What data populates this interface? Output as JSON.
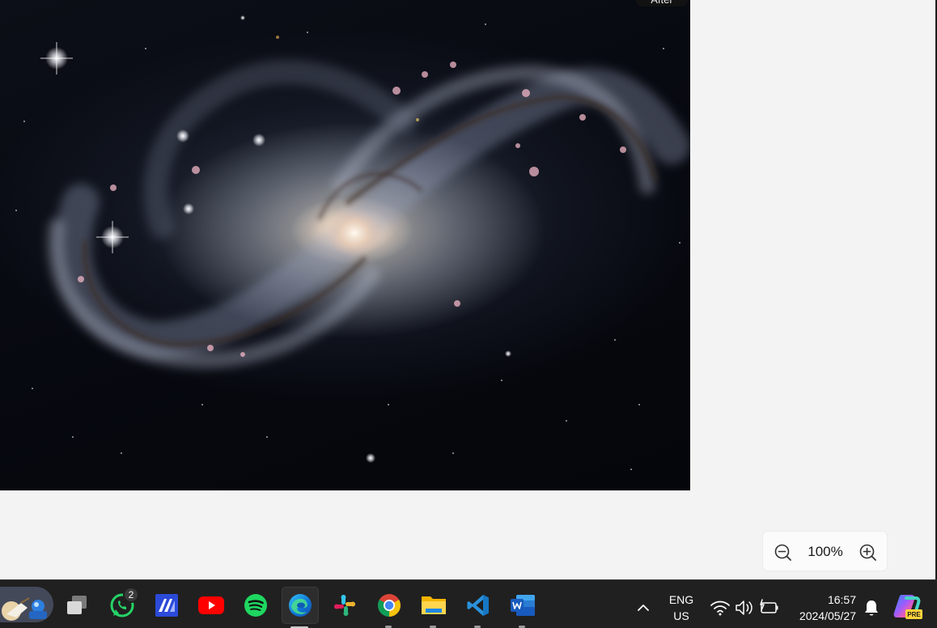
{
  "photo": {
    "alt": "Barred spiral galaxy",
    "compare_label": "After"
  },
  "zoom": {
    "level": "100%",
    "zoom_out_icon": "zoom-out-icon",
    "zoom_in_icon": "zoom-in-icon"
  },
  "taskbar": {
    "apps": [
      {
        "name": "widgets",
        "icon": "weather-widget-icon"
      },
      {
        "name": "task-view",
        "icon": "task-view-icon"
      },
      {
        "name": "whatsapp",
        "icon": "whatsapp-icon",
        "badge": "2"
      },
      {
        "name": "app",
        "icon": "app-icon"
      },
      {
        "name": "youtube",
        "icon": "youtube-icon"
      },
      {
        "name": "spotify",
        "icon": "spotify-icon"
      },
      {
        "name": "edge",
        "icon": "edge-icon",
        "active": true
      },
      {
        "name": "slack",
        "icon": "slack-icon"
      },
      {
        "name": "chrome",
        "icon": "chrome-icon"
      },
      {
        "name": "file-explorer",
        "icon": "folder-icon"
      },
      {
        "name": "vscode",
        "icon": "vscode-icon"
      },
      {
        "name": "word",
        "icon": "word-icon"
      }
    ],
    "tray": {
      "lang_line1": "ENG",
      "lang_line2": "US",
      "time": "16:57",
      "date": "2024/05/27",
      "copilot_badge": "PRE"
    }
  },
  "colors": {
    "taskbar_bg": "#202020",
    "app_bg": "#f3f3f3",
    "accent": "#0078d4"
  }
}
